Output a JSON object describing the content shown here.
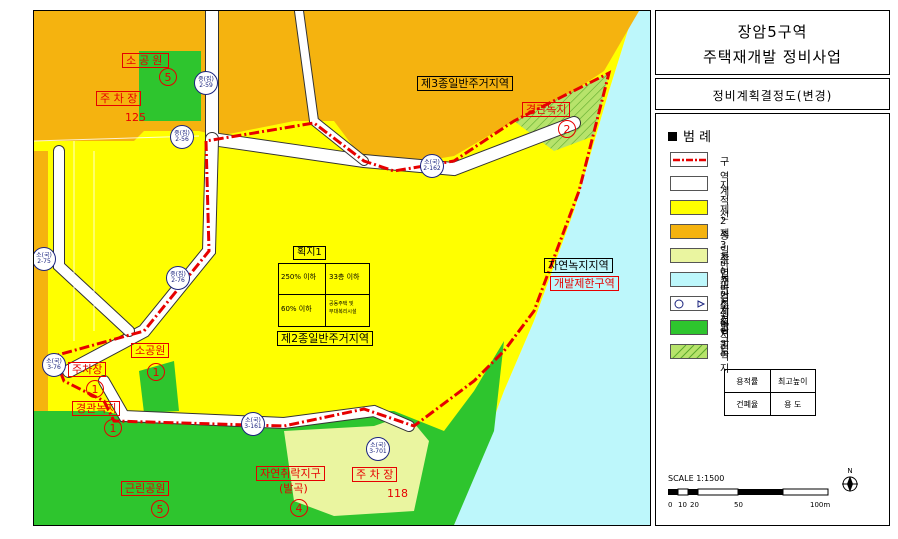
{
  "title": {
    "line1": "장암5구역",
    "line2": "주택재개발 정비사업"
  },
  "subtitle": "정비계획결정도(변경)",
  "legend": {
    "heading": "범 례",
    "items": [
      {
        "label": "구역계",
        "style": "dashdot",
        "color": "#e60000"
      },
      {
        "label": "지적선",
        "style": "outline",
        "color": "#ffffff"
      },
      {
        "label": "제2종일반주거지역",
        "style": "fill",
        "color": "#ffff00"
      },
      {
        "label": "제3종일반주거지역",
        "style": "fill",
        "color": "#f5b30f"
      },
      {
        "label": "자연녹지지역",
        "style": "fill",
        "color": "#eaf5a0"
      },
      {
        "label": "개발제한구역",
        "style": "fill",
        "color": "#bdf7fb"
      },
      {
        "label": "도 로",
        "style": "road",
        "color": "#ffffff"
      },
      {
        "label": "공 원",
        "style": "fill",
        "color": "#2ec52e"
      },
      {
        "label": "녹 지",
        "style": "hatch",
        "color": "#b7e36b"
      }
    ],
    "table": {
      "row1": [
        "용적률",
        "최고높이"
      ],
      "row2": [
        "건폐율",
        "용 도"
      ]
    }
  },
  "scale": {
    "label": "SCALE 1:1500",
    "ticks": [
      "0",
      "10",
      "20",
      "50",
      "100m"
    ],
    "north": "N"
  },
  "map": {
    "zone3_label": "제3종일반주거지역",
    "zone2_label": "제2종일반주거지역",
    "natural_green_label": "자연녹지지역",
    "greenbelt_label": "개발제한구역",
    "block_label": "획지1",
    "block_table": {
      "r1c1": "250% 이하",
      "r1c2": "33층 이하",
      "r2c1": "60% 이하",
      "r2c2a": "공동주택 및",
      "r2c2b": "부대복리시설"
    },
    "facilities": {
      "park_top": "소공원",
      "park_top_no": "5",
      "parking_top": "주 차 장",
      "parking_top_no": "125",
      "landscape_top": "경관녹지",
      "landscape_top_no": "2",
      "park_left": "소공원",
      "park_left_no": "1",
      "parking_left": "주차장",
      "parking_left_no": "1",
      "landscape_left": "경관녹지",
      "landscape_left_no": "1",
      "neighborhood_park": "근린공원",
      "neighborhood_park_no": "5",
      "village": "자연취락지구",
      "village_sub": "(발곡)",
      "village_no": "4",
      "parking_bottom": "주 차 장",
      "parking_bottom_no": "118"
    },
    "roads": [
      {
        "a": "중(집)",
        "b": "2-59"
      },
      {
        "a": "중(집)",
        "b": "2-56"
      },
      {
        "a": "소(국)",
        "b": "2-162"
      },
      {
        "a": "소(국)",
        "b": "2-75"
      },
      {
        "a": "중(집)",
        "b": "2-76"
      },
      {
        "a": "소(국)",
        "b": "3-76"
      },
      {
        "a": "소(국)",
        "b": "3-161"
      },
      {
        "a": "소(국)",
        "b": "3-701"
      }
    ]
  }
}
